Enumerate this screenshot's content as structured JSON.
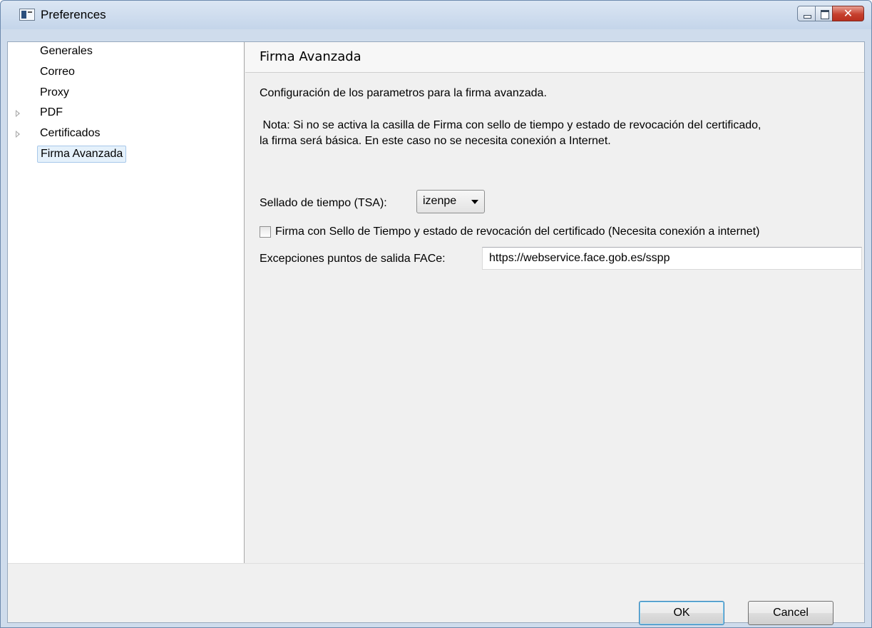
{
  "window": {
    "title": "Preferences",
    "close_glyph": "✕"
  },
  "nav": {
    "items": [
      {
        "label": "Generales",
        "expandable": false,
        "selected": false
      },
      {
        "label": "Correo",
        "expandable": false,
        "selected": false
      },
      {
        "label": "Proxy",
        "expandable": false,
        "selected": false
      },
      {
        "label": "PDF",
        "expandable": true,
        "selected": false
      },
      {
        "label": "Certificados",
        "expandable": true,
        "selected": false
      },
      {
        "label": "Firma Avanzada",
        "expandable": false,
        "selected": true
      }
    ]
  },
  "page": {
    "title": "Firma Avanzada",
    "description": "Configuración de los parametros para la firma avanzada.",
    "note_line1": " Nota: Si no se activa la casilla de Firma con sello de tiempo y estado de revocación del certificado,",
    "note_line2": "la firma será básica. En este caso no se necesita conexión a Internet.",
    "tsa_label": "Sellado de tiempo (TSA):",
    "tsa_value": "izenpe",
    "checkbox_label": "Firma con Sello de Tiempo y estado de revocación del certificado (Necesita conexión a internet)",
    "checkbox_checked": false,
    "exceptions_label": "Excepciones puntos de salida FACe:",
    "exceptions_value": "https://webservice.face.gob.es/sspp"
  },
  "buttons": {
    "ok": "OK",
    "cancel": "Cancel"
  },
  "colors": {
    "selection_bg": "#e5f1fb",
    "selection_border": "#a7c8ea",
    "close_button": "#c6402e"
  }
}
